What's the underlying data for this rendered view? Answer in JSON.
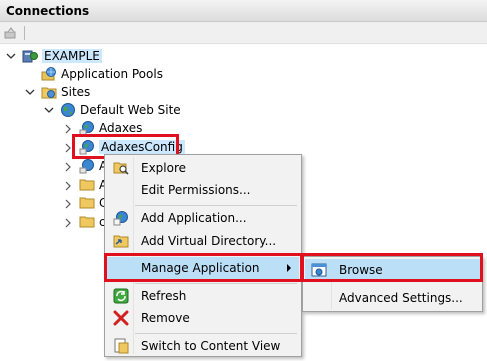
{
  "panel": {
    "title": "Connections"
  },
  "tree": {
    "root": "EXAMPLE",
    "app_pools": "Application Pools",
    "sites": "Sites",
    "default_site": "Default Web Site",
    "children": [
      "Adaxes",
      "AdaxesConfig",
      "A",
      "A",
      "C",
      "c"
    ]
  },
  "context_menu": {
    "items": [
      {
        "label": "Explore",
        "icon": "explore-icon"
      },
      {
        "label": "Edit Permissions...",
        "icon": ""
      },
      {
        "label": "Add Application...",
        "icon": "add-application-icon"
      },
      {
        "label": "Add Virtual Directory...",
        "icon": "add-virtual-directory-icon"
      },
      {
        "label": "Manage Application",
        "icon": ""
      },
      {
        "label": "Refresh",
        "icon": "refresh-icon"
      },
      {
        "label": "Remove",
        "icon": "remove-icon"
      },
      {
        "label": "Switch to Content View",
        "icon": "content-view-icon"
      }
    ]
  },
  "submenu": {
    "items": [
      {
        "label": "Browse",
        "icon": "browse-icon"
      },
      {
        "label": "Advanced Settings...",
        "icon": ""
      }
    ]
  },
  "colors": {
    "highlight": "#e0101e",
    "selection": "#cce8ff",
    "hover": "#bcdff8"
  }
}
